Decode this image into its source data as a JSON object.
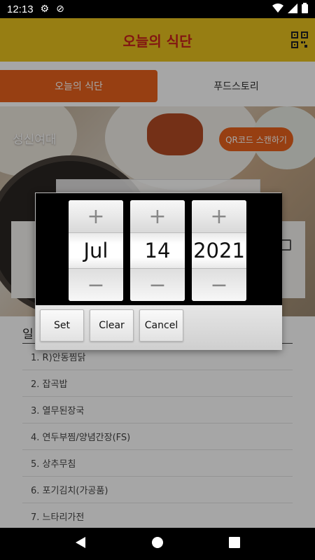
{
  "status_bar": {
    "time": "12:13"
  },
  "app_bar": {
    "title": "오늘의 식단"
  },
  "tabs": [
    {
      "label": "오늘의 식단"
    },
    {
      "label": "푸드스토리"
    }
  ],
  "hero": {
    "school_name": "성신여대",
    "qr_button": "QR코드 스캔하기"
  },
  "menu": {
    "heading": "일",
    "items": [
      "1. R)안동찜닭",
      "2. 잡곡밥",
      "3. 열무된장국",
      "4. 연두부찜/양념간장(FS)",
      "5. 상추무침",
      "6. 포기김치(가공품)",
      "7. 느타리가전"
    ]
  },
  "date_picker": {
    "month": "Jul",
    "day": "14",
    "year": "2021",
    "increment_symbol": "+",
    "decrement_symbol": "−",
    "buttons": {
      "set": "Set",
      "clear": "Clear",
      "cancel": "Cancel"
    }
  },
  "colors": {
    "accent": "#e8621c",
    "app_bar": "#e8c21e",
    "title": "#c8231d"
  }
}
